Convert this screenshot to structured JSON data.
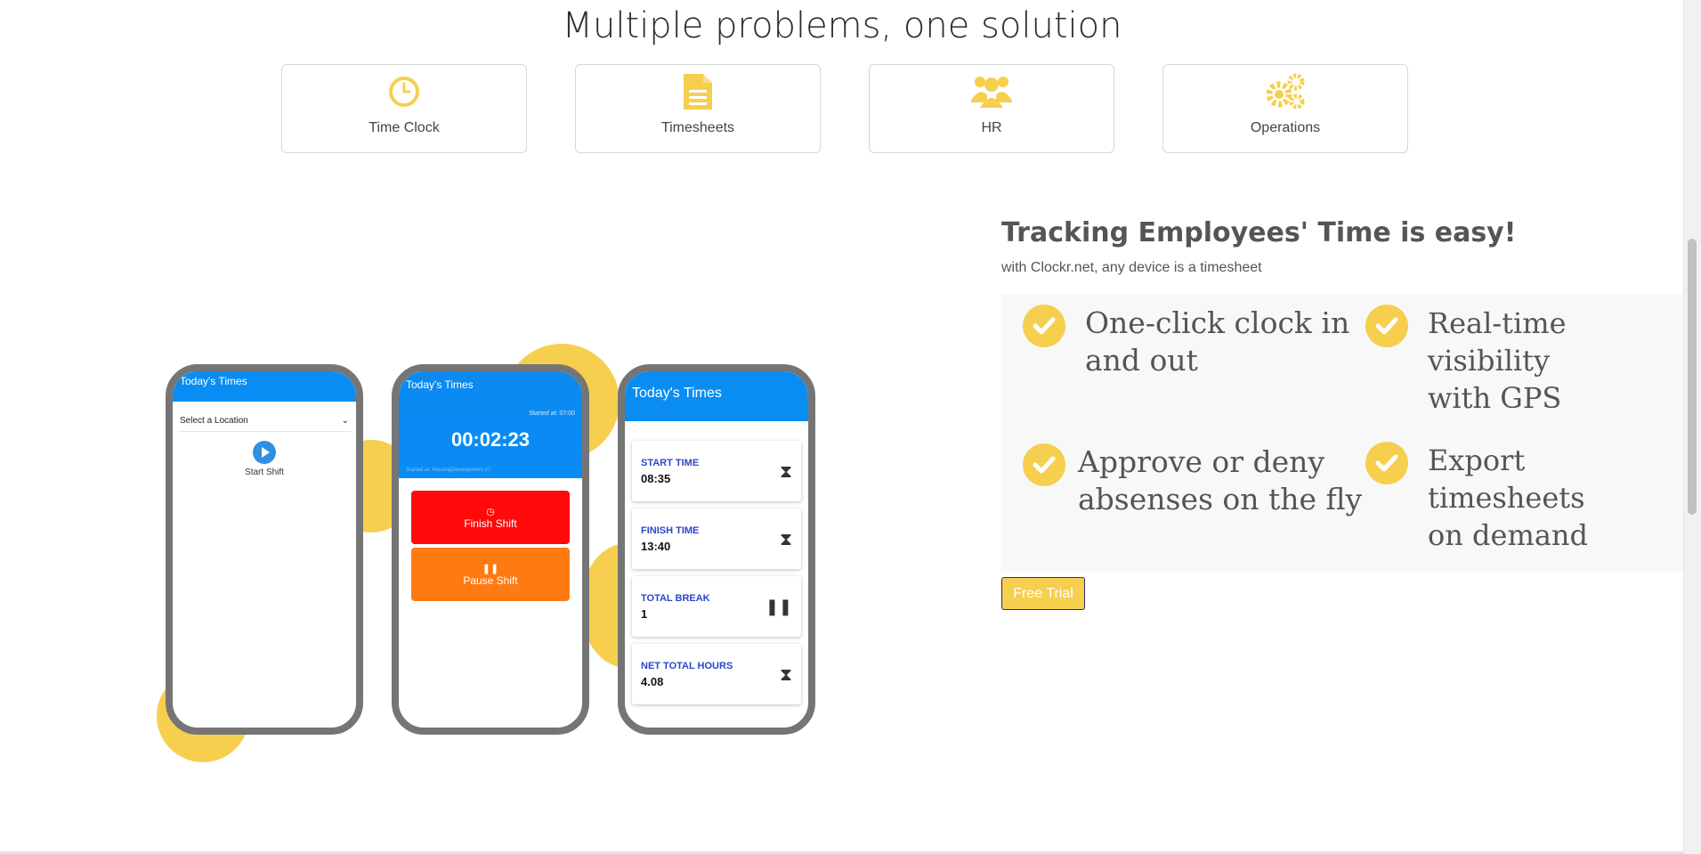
{
  "heading": "Multiple problems, one solution",
  "cards": [
    {
      "label": "Time Clock",
      "icon": "clock-icon"
    },
    {
      "label": "Timesheets",
      "icon": "document-icon"
    },
    {
      "label": "HR",
      "icon": "users-icon"
    },
    {
      "label": "Operations",
      "icon": "gears-icon"
    }
  ],
  "phones": {
    "one": {
      "header": "Today's Times",
      "select_placeholder": "Select a Location",
      "start_label": "Start Shift"
    },
    "two": {
      "header": "Today's Times",
      "started_at": "Started at: 07:00",
      "timer": "00:02:23",
      "location": "Started at: HousingDevelopment #7",
      "finish_label": "Finish Shift",
      "pause_label": "Pause Shift"
    },
    "three": {
      "header": "Today's Times",
      "rows": [
        {
          "key": "START TIME",
          "value": "08:35",
          "icon": "hourglass-icon"
        },
        {
          "key": "FINISH TIME",
          "value": "13:40",
          "icon": "hourglass-icon"
        },
        {
          "key": "TOTAL BREAK",
          "value": "1",
          "icon": "pause-icon"
        },
        {
          "key": "NET TOTAL HOURS",
          "value": "4.08",
          "icon": "hourglass-icon"
        }
      ]
    }
  },
  "tracking": {
    "title": "Tracking Employees' Time is easy!",
    "subtitle": "with Clockr.net, any device is a timesheet",
    "features": [
      {
        "line1": "One-click clock in",
        "line2": "and out"
      },
      {
        "line1": "Real-time visibility",
        "line2": "with GPS"
      },
      {
        "line1": "Approve or deny",
        "line2": "absenses on the fly"
      },
      {
        "line1": "Export timesheets",
        "line2": "on demand"
      }
    ],
    "cta": "Free Trial"
  },
  "colors": {
    "accent": "#f6cf4f",
    "blue": "#0a8df2",
    "red": "#ff0a0a",
    "orange": "#ff7a12"
  }
}
